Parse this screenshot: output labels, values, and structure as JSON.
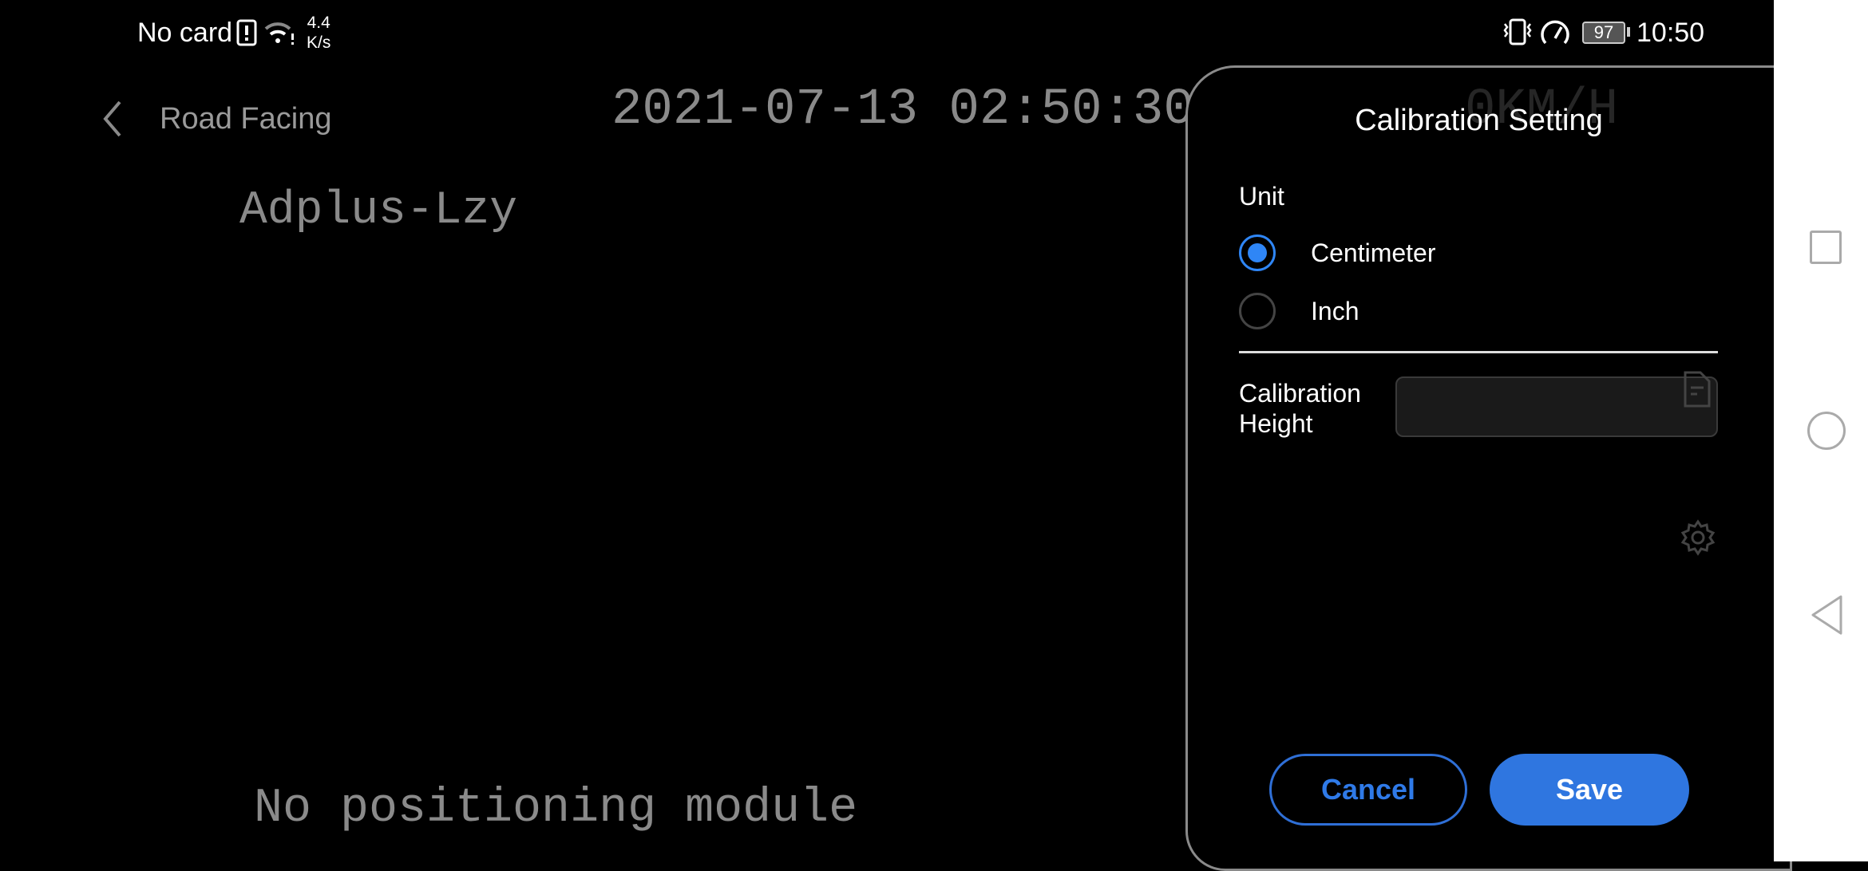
{
  "status_bar": {
    "carrier": "No card",
    "net_speed_value": "4.4",
    "net_speed_unit": "K/s",
    "battery": "97",
    "time": "10:50",
    "icons": [
      "sim-alert-icon",
      "wifi-icon",
      "vibrate-icon",
      "speedometer-icon",
      "battery-icon"
    ]
  },
  "header": {
    "title": "Road Facing",
    "back_icon": "chevron-left-icon"
  },
  "video_osd": {
    "timestamp": "2021-07-13 02:50:30",
    "speed": "0KM/H",
    "device": "Adplus-Lzy",
    "gps_status": "No positioning module"
  },
  "dialog": {
    "title": "Calibration Setting",
    "unit_label": "Unit",
    "options": [
      {
        "label": "Centimeter",
        "selected": true
      },
      {
        "label": "Inch",
        "selected": false
      }
    ],
    "height_label_line1": "Calibration",
    "height_label_line2": "Height",
    "height_value": "",
    "cancel_label": "Cancel",
    "save_label": "Save",
    "accent": "#2f86f6"
  },
  "nav_bar": {
    "icons": [
      "recent-apps-icon",
      "home-icon",
      "back-icon"
    ]
  }
}
